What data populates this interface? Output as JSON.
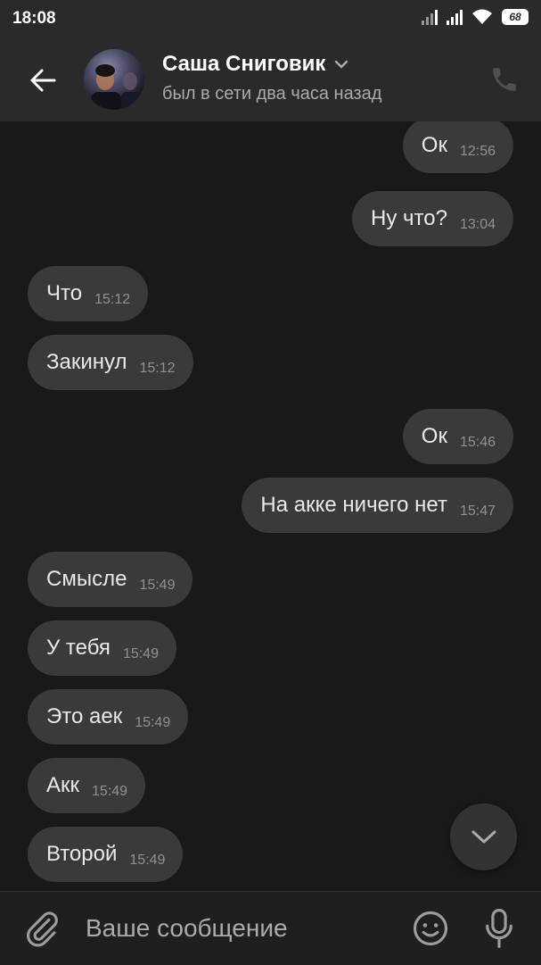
{
  "status_bar": {
    "time": "18:08",
    "battery": "68"
  },
  "header": {
    "name": "Саша Сниговик",
    "status": "был в сети два часа назад"
  },
  "messages": [
    {
      "text": "Ок",
      "time": "12:56",
      "direction": "out"
    },
    {
      "text": "Ну что?",
      "time": "13:04",
      "direction": "out"
    },
    {
      "text": "Что",
      "time": "15:12",
      "direction": "in"
    },
    {
      "text": "Закинул",
      "time": "15:12",
      "direction": "in"
    },
    {
      "text": "Ок",
      "time": "15:46",
      "direction": "out"
    },
    {
      "text": "На акке ничего нет",
      "time": "15:47",
      "direction": "out"
    },
    {
      "text": "Смысле",
      "time": "15:49",
      "direction": "in"
    },
    {
      "text": "У тебя",
      "time": "15:49",
      "direction": "in"
    },
    {
      "text": "Это аек",
      "time": "15:49",
      "direction": "in"
    },
    {
      "text": "Акк",
      "time": "15:49",
      "direction": "in"
    },
    {
      "text": "Второй",
      "time": "15:49",
      "direction": "in"
    }
  ],
  "composer": {
    "placeholder": "Ваше сообщение"
  },
  "icons": {
    "back": "arrow-left-icon",
    "call": "phone-icon",
    "attach": "paperclip-icon",
    "emoji": "smile-icon",
    "mic": "microphone-icon",
    "scroll": "chevron-down-icon"
  },
  "colors": {
    "background": "#19191a",
    "bubble": "#3a3a3c",
    "header": "#2a2a2b"
  }
}
